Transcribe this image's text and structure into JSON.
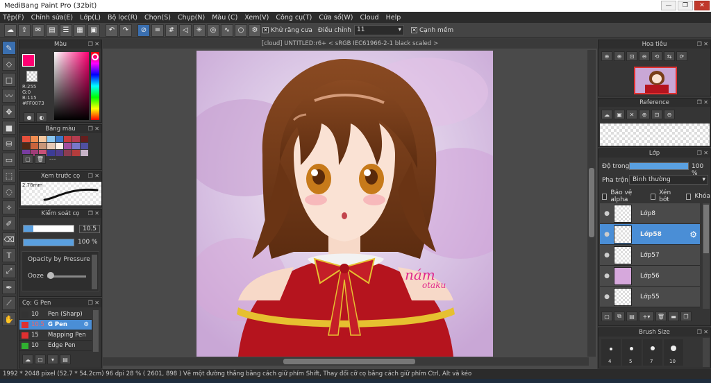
{
  "window": {
    "title": "MediBang Paint Pro (32bit)"
  },
  "menu": [
    "Tệp(F)",
    "Chỉnh sửa(E)",
    "Lớp(L)",
    "Bộ lọc(R)",
    "Chọn(S)",
    "Chụp(N)",
    "Màu (C)",
    "Xem(V)",
    "Công cụ(T)",
    "Cửa sổ(W)",
    "Cloud",
    "Help"
  ],
  "toolbar": {
    "antialias_label": "Khử răng cưa",
    "correction_label": "Điều chỉnh",
    "correction_value": "11",
    "soft_edge_label": "Cạnh mềm"
  },
  "document": {
    "tab_title": "[cloud] UNTITLED:r6+ < sRGB IEC61966-2-1 black scaled >"
  },
  "color_panel": {
    "title": "Màu",
    "r": "R:255",
    "g": "G:0",
    "b": "B:115",
    "hex": "#FF0073",
    "main_color": "#FF0073"
  },
  "palette_panel": {
    "title": "Bảng màu",
    "swatches": [
      "#e6503c",
      "#f08c50",
      "#f5c8a0",
      "#8cc8f0",
      "#3c78c8",
      "#c83c3c",
      "#b43c50",
      "#641e1e",
      "#502814",
      "#c8643c",
      "#c89678",
      "#e6c8b4",
      "#fff0e6",
      "#a050a0",
      "#7878c8",
      "#5050a0",
      "#783ca0",
      "#a03c78",
      "#c85078",
      "#3c3c96",
      "#503c8c",
      "#8c3c50",
      "#b43c3c",
      "#c8b4c8"
    ],
    "dash_text": "---"
  },
  "brush_preview": {
    "title": "Xem trước cọ",
    "size": "2.78mm"
  },
  "brush_control": {
    "title": "Kiểm soát cọ",
    "size": "10.5",
    "opacity": "100 %",
    "opacity_pressure_label": "Opacity by Pressure",
    "ooze_label": "Ooze"
  },
  "brush_list": {
    "title": "Cọ: G Pen",
    "items": [
      {
        "size": "10",
        "name": "Pen (Sharp)",
        "color": "#333333"
      },
      {
        "size": "10.5",
        "name": "G Pen",
        "color": "#e03030"
      },
      {
        "size": "15",
        "name": "Mapping Pen",
        "color": "#e03030"
      },
      {
        "size": "10",
        "name": "Edge Pen",
        "color": "#30b030"
      }
    ]
  },
  "navigator": {
    "title": "Hoa tiêu"
  },
  "reference": {
    "title": "Reference"
  },
  "layer_panel": {
    "title": "Lớp",
    "opacity_label": "Độ trong",
    "opacity_value": "100 %",
    "opacity_level": 100,
    "blend_label": "Pha trộn",
    "blend_value": "Bình thường",
    "protect_alpha": "Bảo vệ alpha",
    "clip": "Xén bớt",
    "lock": "Khóa",
    "layers": [
      {
        "name": "Lớp8"
      },
      {
        "name": "Lớp58"
      },
      {
        "name": "Lớp57"
      },
      {
        "name": "Lớp56"
      },
      {
        "name": "Lớp55"
      }
    ]
  },
  "brush_size_panel": {
    "title": "Brush Size",
    "sizes": [
      "4",
      "5",
      "7",
      "10"
    ]
  },
  "artwork": {
    "signature": "nám otaku"
  },
  "status": {
    "text": "1992 * 2048 pixel   (52.7 * 54.2cm)   96 dpi   28 %   ( 2601, 898 )   Vẽ một đường thẳng bằng cách giữ phím Shift, Thay đổi cỡ cọ bằng cách giữ phím Ctrl, Alt và kéo"
  }
}
